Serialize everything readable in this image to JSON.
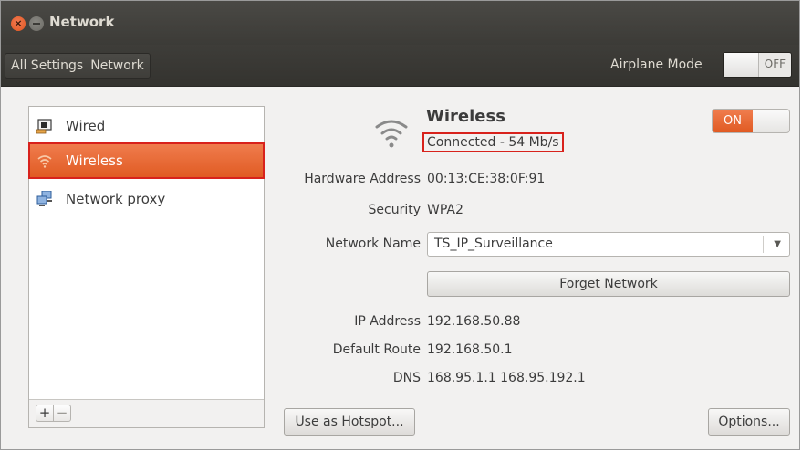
{
  "window": {
    "title": "Network"
  },
  "toolbar": {
    "crumbs": [
      "All Settings",
      "Network"
    ],
    "airplane_label": "Airplane Mode",
    "airplane_state": "OFF"
  },
  "sidebar": {
    "items": [
      {
        "label": "Wired",
        "icon": "wired-icon",
        "selected": false
      },
      {
        "label": "Wireless",
        "icon": "wifi-icon",
        "selected": true
      },
      {
        "label": "Network proxy",
        "icon": "proxy-icon",
        "selected": false
      }
    ],
    "add_label": "+",
    "remove_label": "−"
  },
  "detail": {
    "heading": "Wireless",
    "status": "Connected - 54 Mb/s",
    "power_label": "ON",
    "hardware_label": "Hardware Address",
    "hardware_value": "00:13:CE:38:0F:91",
    "security_label": "Security",
    "security_value": "WPA2",
    "network_name_label": "Network Name",
    "network_name_value": "TS_IP_Surveillance",
    "forget_label": "Forget Network",
    "ip_label": "IP Address",
    "ip_value": "192.168.50.88",
    "route_label": "Default Route",
    "route_value": "192.168.50.1",
    "dns_label": "DNS",
    "dns_value": "168.95.1.1 168.95.192.1",
    "hotspot_label": "Use as Hotspot...",
    "options_label": "Options..."
  },
  "colors": {
    "accent": "#e9622e",
    "highlight_box": "#d8221c",
    "titlebar": "#3c3b37"
  }
}
